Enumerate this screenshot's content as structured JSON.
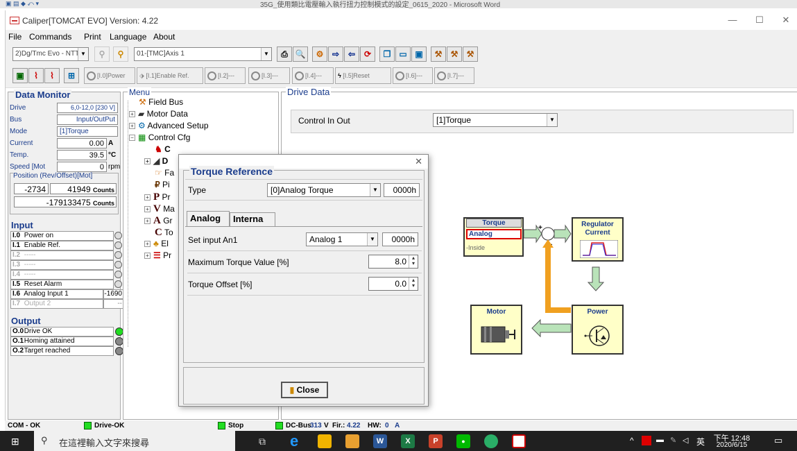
{
  "background_window": {
    "title": "35G_使用類比電壓輸入執行扭力控制模式的設定_0615_2020 - Microsoft Word"
  },
  "window": {
    "title": "Caliper[TOMCAT EVO] Version: 4.22"
  },
  "menu": {
    "file": "File",
    "commands": "Commands",
    "print": "Print",
    "language": "Language",
    "about": "About"
  },
  "toolbar": {
    "device_combo": "2)Dg/Tmc Evo - NTT",
    "axis_combo": "01-[TMC]Axis 1"
  },
  "commands": {
    "power": "[I.0]Power",
    "enable_ref": "[I.1]Enable Ref.",
    "i2": "[I.2]---",
    "i3": "[I.3]---",
    "i4": "[I.4]---",
    "reset": "[I.5]Reset",
    "i6": "[I.6]---",
    "i7": "[I.7]---"
  },
  "data_monitor": {
    "title": "Data Monitor",
    "rows": [
      {
        "label": "Drive",
        "value": "6,0-12,0 [230 V]",
        "unit": ""
      },
      {
        "label": "Bus",
        "value": "Input/OutPut",
        "unit": ""
      },
      {
        "label": "Mode",
        "value": "[1]Torque",
        "unit": ""
      },
      {
        "label": "Current",
        "value": "0.00",
        "unit": "A"
      },
      {
        "label": "Temp.",
        "value": "39.5",
        "unit": "°C"
      },
      {
        "label": "Speed [Mot",
        "value": "0",
        "unit": "rpm"
      }
    ],
    "position_title": "Position (Rev/Offset)[Mot]",
    "position_rev": "-2734",
    "position_offset": "41949",
    "position_abs": "-179133475",
    "counts_label": "Counts"
  },
  "input": {
    "title": "Input",
    "items": [
      {
        "id": "I.0",
        "label": "Power on"
      },
      {
        "id": "I.1",
        "label": "Enable Ref."
      },
      {
        "id": "I.2",
        "label": "-----"
      },
      {
        "id": "I.3",
        "label": "-----"
      },
      {
        "id": "I.4",
        "label": "-----"
      },
      {
        "id": "I.5",
        "label": "Reset Alarm"
      },
      {
        "id": "I.6",
        "label": "Analog Input 1",
        "value": "-1690"
      },
      {
        "id": "I.7",
        "label": "Output 2",
        "value": "--"
      }
    ]
  },
  "output": {
    "title": "Output",
    "items": [
      {
        "id": "O.0",
        "label": "Drive OK",
        "color": "#22dd22"
      },
      {
        "id": "O.1",
        "label": "Homing attained",
        "color": "#888888"
      },
      {
        "id": "O.2",
        "label": "Target reached",
        "color": "#888888"
      }
    ]
  },
  "menu_tree": {
    "title": "Menu",
    "items": [
      {
        "label": "Field Bus",
        "icon": "fieldbus-icon"
      },
      {
        "label": "Motor Data",
        "icon": "motor-icon"
      },
      {
        "label": "Advanced Setup",
        "icon": "advanced-icon"
      },
      {
        "label": "Control Cfg",
        "icon": "control-icon"
      },
      {
        "label": "C",
        "icon": "c-icon"
      },
      {
        "label": "D",
        "icon": "d-icon"
      },
      {
        "label": "Fa",
        "icon": "fa-icon"
      },
      {
        "label": "Pi",
        "icon": "pi-icon"
      },
      {
        "label": "Pr",
        "icon": "p-icon"
      },
      {
        "label": "Ma",
        "icon": "v-icon"
      },
      {
        "label": "Gr",
        "icon": "a-icon"
      },
      {
        "label": "To",
        "icon": "c2-icon"
      },
      {
        "label": "El",
        "icon": "el-icon"
      },
      {
        "label": "Pr",
        "icon": "pr-icon"
      }
    ]
  },
  "drive_data": {
    "title": "Drive Data",
    "section_label": "Control In Out",
    "section_value": "[1]Torque",
    "diagram": {
      "torque": "Torque",
      "analog": "Analog",
      "inside": "-Inside",
      "regulator": "Regulator",
      "current": "Current",
      "motor": "Motor",
      "power": "Power"
    }
  },
  "dialog": {
    "title": "Torque Reference",
    "type_label": "Type",
    "type_value": "[0]Analog Torque",
    "type_code": "0000h",
    "tab_analog": "Analog",
    "tab_internal": "Interna",
    "set_input_label": "Set input An1",
    "set_input_value": "Analog 1",
    "set_input_code": "0000h",
    "max_torque_label": "Maximum Torque Value [%]",
    "max_torque_value": "8.0",
    "torque_offset_label": "Torque Offset [%]",
    "torque_offset_value": "0.0",
    "close_label": "Close"
  },
  "status": {
    "com": "COM - OK",
    "drive": "Drive-OK",
    "stop": "Stop",
    "dcbus_label": "DC-Bus",
    "dcbus_value": "313",
    "dcbus_unit": "V",
    "fir_label": "Fir.:",
    "fir_value": "4.22",
    "hw_label": "HW:",
    "hw_value": "0",
    "hw_rev": "A"
  },
  "taskbar": {
    "search_placeholder": "在這裡輸入文字來搜尋",
    "ime": "英",
    "time": "下午 12:48",
    "date": "2020/6/15"
  }
}
